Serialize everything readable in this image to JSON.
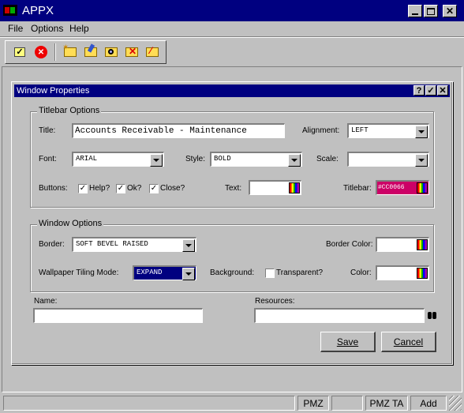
{
  "app": {
    "title": "APPX"
  },
  "menu": {
    "file": "File",
    "options": "Options",
    "help": "Help"
  },
  "toolbar": {
    "icons": [
      "check-icon",
      "cancel-icon",
      "new-folder-icon",
      "edit-folder-icon",
      "find-folder-icon",
      "delete-folder-icon",
      "remove-folder-icon"
    ]
  },
  "dialog": {
    "title": "Window Properties",
    "help_label": "?",
    "titlebar_group": {
      "legend": "Titlebar Options",
      "title_label": "Title:",
      "title_value": "Accounts Receivable - Maintenance",
      "alignment_label": "Alignment:",
      "alignment_value": "LEFT",
      "font_label": "Font:",
      "font_value": "ARIAL",
      "style_label": "Style:",
      "style_value": "BOLD",
      "scale_label": "Scale:",
      "scale_value": "",
      "buttons_label": "Buttons:",
      "help_chk": "Help?",
      "ok_chk": "Ok?",
      "close_chk": "Close?",
      "text_label": "Text:",
      "titlebar_label": "Titlebar:",
      "titlebar_color_value": "#CC0066",
      "titlebar_color": "#cc0066"
    },
    "window_group": {
      "legend": "Window Options",
      "border_label": "Border:",
      "border_value": "SOFT BEVEL RAISED",
      "border_color_label": "Border Color:",
      "wallpaper_label": "Wallpaper Tiling Mode:",
      "wallpaper_value": "EXPAND",
      "background_label": "Background:",
      "transparent_chk": "Transparent?",
      "color_label": "Color:"
    },
    "name_label": "Name:",
    "resources_label": "Resources:",
    "save_label": "Save",
    "cancel_label": "Cancel"
  },
  "status": {
    "pmz": "PMZ",
    "pmzta": "PMZ TA",
    "mode": "Add"
  }
}
